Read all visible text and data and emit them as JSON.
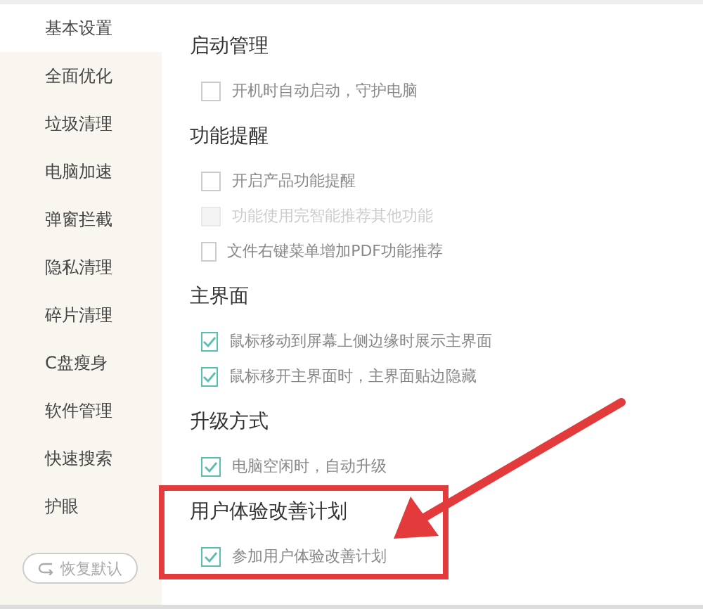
{
  "sidebar": {
    "items": [
      {
        "label": "基本设置",
        "selected": true
      },
      {
        "label": "全面优化",
        "selected": false
      },
      {
        "label": "垃圾清理",
        "selected": false
      },
      {
        "label": "电脑加速",
        "selected": false
      },
      {
        "label": "弹窗拦截",
        "selected": false
      },
      {
        "label": "隐私清理",
        "selected": false
      },
      {
        "label": "碎片清理",
        "selected": false
      },
      {
        "label": "C盘瘦身",
        "selected": false
      },
      {
        "label": "软件管理",
        "selected": false
      },
      {
        "label": "快速搜索",
        "selected": false
      },
      {
        "label": "护眼",
        "selected": false
      }
    ],
    "restore_button": "恢复默认"
  },
  "sections": [
    {
      "title": "启动管理",
      "highlighted": false,
      "options": [
        {
          "label": "开机时自动启动，守护电脑",
          "checked": false,
          "disabled": false
        }
      ]
    },
    {
      "title": "功能提醒",
      "highlighted": false,
      "options": [
        {
          "label": "开启产品功能提醒",
          "checked": false,
          "disabled": false
        },
        {
          "label": "功能使用完智能推荐其他功能",
          "checked": false,
          "disabled": true
        },
        {
          "label": "文件右键菜单增加PDF功能推荐",
          "checked": false,
          "disabled": false
        }
      ]
    },
    {
      "title": "主界面",
      "highlighted": false,
      "options": [
        {
          "label": "鼠标移动到屏幕上侧边缘时展示主界面",
          "checked": true,
          "disabled": false
        },
        {
          "label": "鼠标移开主界面时，主界面贴边隐藏",
          "checked": true,
          "disabled": false
        }
      ]
    },
    {
      "title": "升级方式",
      "highlighted": false,
      "options": [
        {
          "label": "电脑空闲时，自动升级",
          "checked": true,
          "disabled": false
        }
      ]
    },
    {
      "title": "用户体验改善计划",
      "highlighted": true,
      "options": [
        {
          "label": "参加用户体验改善计划",
          "checked": true,
          "disabled": false
        }
      ]
    }
  ]
}
